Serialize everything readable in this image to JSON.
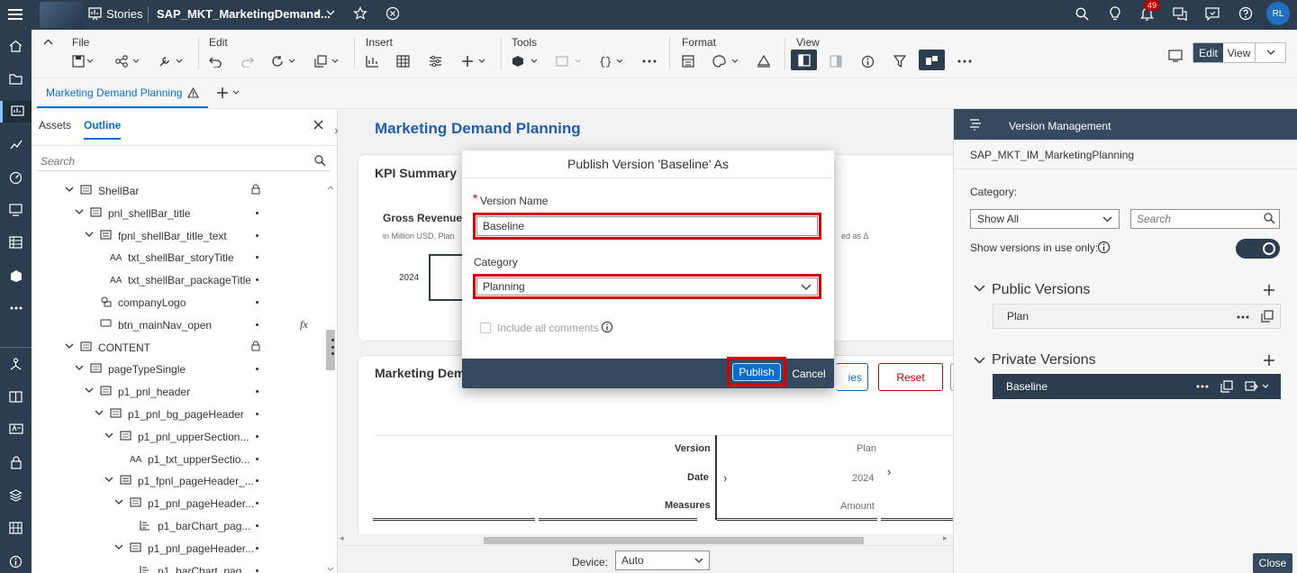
{
  "topbar": {
    "app_title": "Stories",
    "story_title": "SAP_MKT_MarketingDemand...",
    "modified_marker": "•",
    "notification_count": "49",
    "avatar_initials": "RL"
  },
  "toolbar": {
    "groups": {
      "file": "File",
      "edit": "Edit",
      "insert": "Insert",
      "tools": "Tools",
      "format": "Format",
      "view": "View"
    },
    "edit_mode": "Edit",
    "view_mode": "View"
  },
  "tabs": {
    "page_tab": "Marketing Demand Planning"
  },
  "outline": {
    "tabs": [
      "Assets",
      "Outline"
    ],
    "search_placeholder": "Search",
    "rows": [
      {
        "label": "ShellBar"
      },
      {
        "label": "pnl_shellBar_title"
      },
      {
        "label": "fpnl_shellBar_title_text"
      },
      {
        "label": "txt_shellBar_storyTitle"
      },
      {
        "label": "txt_shellBar_packageTitle"
      },
      {
        "label": "companyLogo"
      },
      {
        "label": "btn_mainNav_open"
      },
      {
        "label": "CONTENT"
      },
      {
        "label": "pageTypeSingle"
      },
      {
        "label": "p1_pnl_header"
      },
      {
        "label": "p1_pnl_bg_pageHeader"
      },
      {
        "label": "p1_pnl_upperSection..."
      },
      {
        "label": "p1_txt_upperSectio..."
      },
      {
        "label": "p1_fpnl_pageHeader_..."
      },
      {
        "label": "p1_pnl_pageHeader..."
      },
      {
        "label": "p1_barChart_pag..."
      },
      {
        "label": "p1_pnl_pageHeader..."
      },
      {
        "label": "p1_barChart_pag..."
      }
    ],
    "fx_label": "fx"
  },
  "canvas": {
    "page_title": "Marketing Demand Planning",
    "kpi_title": "KPI Summary",
    "gross_revenue_title": "Gross Revenue",
    "gross_revenue_sub": "in Million USD, Plan",
    "delta_suffix": "ed as Δ",
    "year_label": "2024",
    "table_title": "Marketing Dema",
    "btn_ies": "ies",
    "btn_reset": "Reset",
    "row_version": "Version",
    "row_date": "Date",
    "row_measures": "Measures",
    "val_plan": "Plan",
    "val_2024": "2024",
    "val_amount": "Amount",
    "device_label": "Device:",
    "device_value": "Auto"
  },
  "version_mgmt": {
    "header": "Version Management",
    "model": "SAP_MKT_IM_MarketingPlanning",
    "category_label": "Category:",
    "category_value": "Show All",
    "search_placeholder": "Search",
    "show_in_use_label": "Show versions in use only:",
    "public_title": "Public Versions",
    "public_items": [
      "Plan"
    ],
    "private_title": "Private Versions",
    "private_items": [
      "Baseline"
    ],
    "close_label": "Close"
  },
  "dialog": {
    "title": "Publish Version 'Baseline' As",
    "required_mark": "*",
    "version_name_label": "Version Name",
    "version_name_value": "Baseline",
    "category_label": "Category",
    "category_value": "Planning",
    "include_comments_label": "Include all comments",
    "publish_label": "Publish",
    "cancel_label": "Cancel"
  },
  "colors": {
    "shell": "#2b3d4f",
    "accent": "#0a6ed1",
    "highlight": "#d3000b",
    "title_blue": "#1f5fb0",
    "footer": "#354a5f"
  }
}
